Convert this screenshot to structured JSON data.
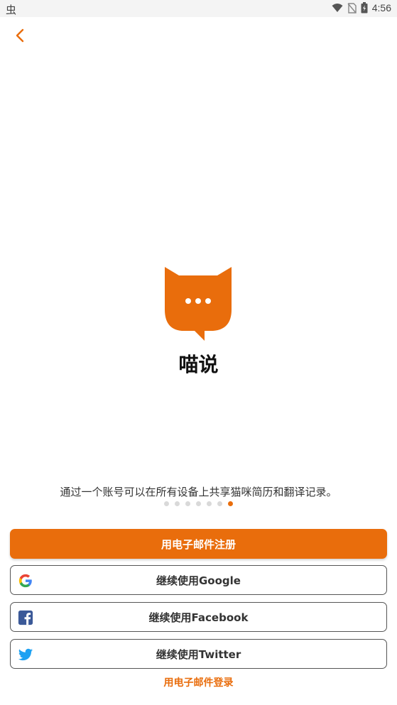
{
  "status_bar": {
    "left_glyph": "虫",
    "time": "4:56",
    "icons": [
      "wifi-icon",
      "no-sim-icon",
      "battery-icon"
    ]
  },
  "nav": {
    "back_icon": "chevron-left-icon"
  },
  "app": {
    "name": "喵说",
    "logo_icon": "cat-speech-bubble-logo"
  },
  "onboarding": {
    "tagline": "通过一个账号可以在所有设备上共享猫咪简历和翻译记录。",
    "page_count": 7,
    "active_page": 7
  },
  "actions": {
    "register_email": "用电子邮件注册",
    "continue_google": "继续使用Google",
    "continue_facebook": "继续使用Facebook",
    "continue_twitter": "继续使用Twitter",
    "login_email": "用电子邮件登录"
  },
  "colors": {
    "accent": "#e96d0c",
    "facebook": "#3b5998",
    "twitter": "#1da1f2"
  }
}
